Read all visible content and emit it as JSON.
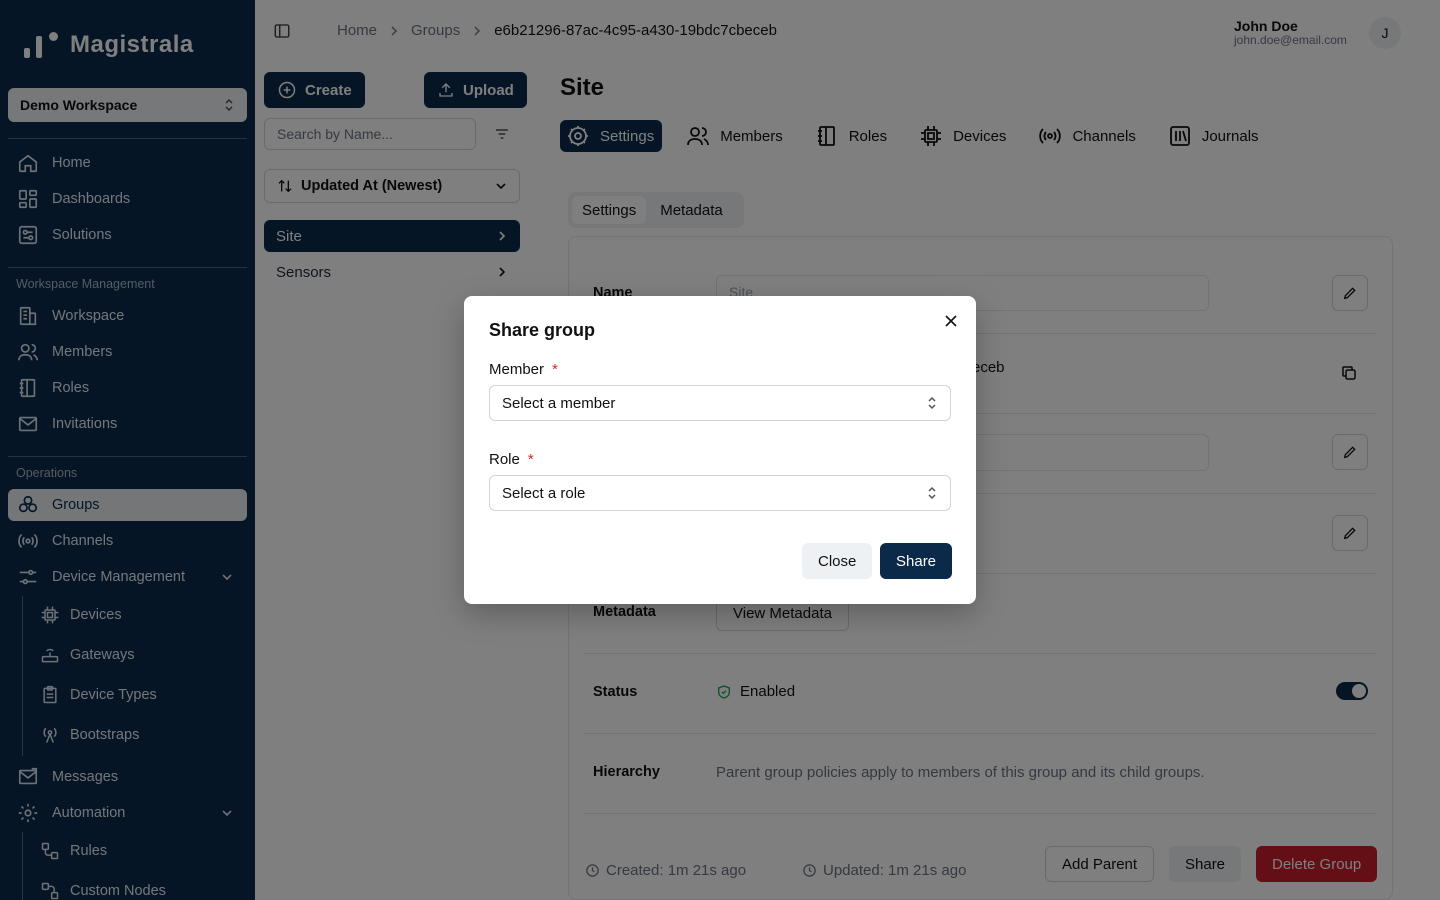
{
  "app": {
    "name": "Magistrala"
  },
  "sidebar": {
    "workspace": "Demo Workspace",
    "top_items": [
      {
        "label": "Home",
        "icon": "home-icon"
      },
      {
        "label": "Dashboards",
        "icon": "dashboard-icon"
      },
      {
        "label": "Solutions",
        "icon": "solutions-icon"
      }
    ],
    "section_workspace": "Workspace Management",
    "workspace_items": [
      {
        "label": "Workspace",
        "icon": "building-icon"
      },
      {
        "label": "Members",
        "icon": "users-icon"
      },
      {
        "label": "Roles",
        "icon": "notebook-icon"
      },
      {
        "label": "Invitations",
        "icon": "mail-icon"
      }
    ],
    "section_operations": "Operations",
    "operations_items": [
      {
        "label": "Groups",
        "icon": "groups-icon"
      },
      {
        "label": "Channels",
        "icon": "radio-icon"
      },
      {
        "label": "Device Management",
        "icon": "settings-sliders-icon"
      }
    ],
    "device_sub": [
      {
        "label": "Devices",
        "icon": "chip-icon"
      },
      {
        "label": "Gateways",
        "icon": "router-icon"
      },
      {
        "label": "Device Types",
        "icon": "clipboard-icon"
      },
      {
        "label": "Bootstraps",
        "icon": "antenna-icon"
      }
    ],
    "messages": "Messages",
    "automation": "Automation",
    "automation_sub": [
      {
        "label": "Rules",
        "icon": "rules-icon"
      },
      {
        "label": "Custom Nodes",
        "icon": "nodes-icon"
      }
    ]
  },
  "breadcrumb": [
    "Home",
    "Groups",
    "e6b21296-87ac-4c95-a430-19bdc7cbeceb"
  ],
  "user": {
    "name": "John Doe",
    "email": "john.doe@email.com",
    "initial": "J"
  },
  "list_panel": {
    "create_label": "Create",
    "upload_label": "Upload",
    "search_placeholder": "Search by Name...",
    "sort_label": "Updated At (Newest)",
    "items": [
      "Site",
      "Sensors"
    ]
  },
  "detail": {
    "title": "Site",
    "tabs": [
      "Settings",
      "Members",
      "Roles",
      "Devices",
      "Channels",
      "Journals"
    ],
    "subtabs": [
      "Settings",
      "Metadata"
    ],
    "name_label": "Name",
    "name_placeholder": "Site",
    "id_suffix": "eceb",
    "metadata_label": "Metadata",
    "view_metadata": "View Metadata",
    "status_label": "Status",
    "status_value": "Enabled",
    "hierarchy_label": "Hierarchy",
    "hierarchy_text": "Parent group policies apply to members of this group and its child groups.",
    "created": "Created: 1m 21s ago",
    "updated": "Updated: 1m 21s ago",
    "add_parent": "Add Parent",
    "share": "Share",
    "delete": "Delete Group"
  },
  "dialog": {
    "title": "Share group",
    "member_label": "Member",
    "member_placeholder": "Select a member",
    "role_label": "Role",
    "role_placeholder": "Select a role",
    "required_mark": "*",
    "close_label": "Close",
    "share_label": "Share"
  },
  "colors": {
    "primary": "#0b2a4a",
    "danger": "#c81e2b",
    "required": "#dc2626"
  }
}
